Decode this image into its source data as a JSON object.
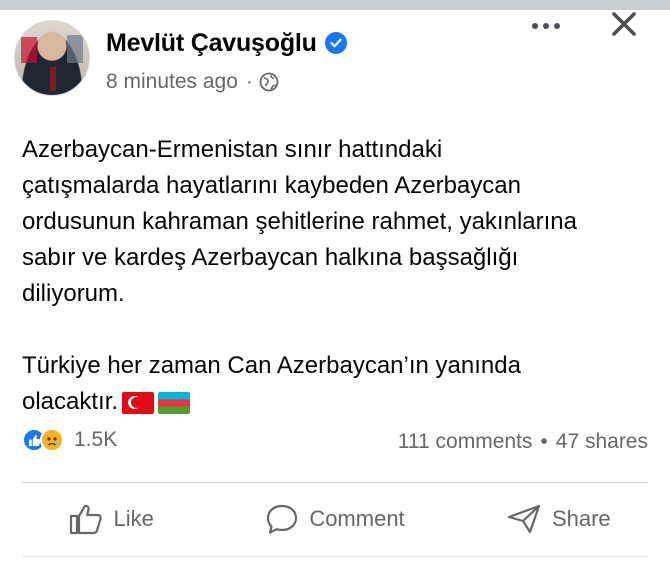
{
  "post": {
    "author_name": "Mevlüt Çavuşoğlu",
    "verified": true,
    "timestamp": "8 minutes ago",
    "meta_separator": "·",
    "privacy_icon": "globe-icon",
    "body_paragraph_1": "Azerbaycan-Ermenistan sınır hattındaki\nçatışmalarda hayatlarını kaybeden Azerbaycan\nordusunun kahraman şehitlerine rahmet, yakınlarına\nsabır ve kardeş Azerbaycan halkına başsağlığı\ndiliyorum.",
    "body_paragraph_2": "Türkiye her zaman Can Azerbaycan’ın yanında\nolacaktır.",
    "flag_emojis": [
      "turkey-flag",
      "azerbaijan-flag"
    ]
  },
  "reactions": {
    "types": [
      "like",
      "sad"
    ],
    "count": "1.5K"
  },
  "engagement": {
    "comments": "111 comments",
    "separator": "•",
    "shares": "47 shares"
  },
  "actions": {
    "like_label": "Like",
    "comment_label": "Comment",
    "share_label": "Share"
  },
  "colors": {
    "brand_blue": "#1877f2",
    "secondary_text": "#65676b",
    "reaction_sad": "#f7b125"
  }
}
